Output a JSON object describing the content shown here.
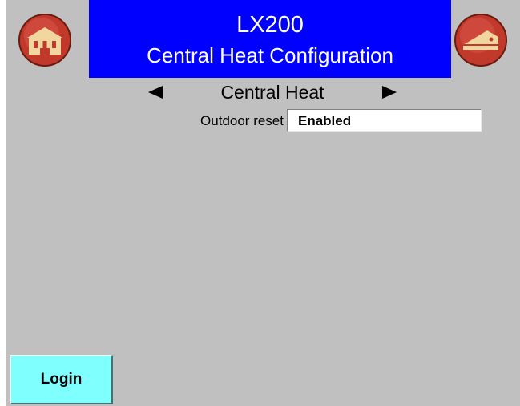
{
  "header": {
    "title": "LX200",
    "subtitle": "Central Heat Configuration",
    "bar_color": "#0000ff",
    "home_icon": "building-icon",
    "back_icon": "exit-icon",
    "button_color": "#c0392b"
  },
  "section_nav": {
    "title": "Central Heat",
    "prev_icon": "left-arrow-icon",
    "next_icon": "right-arrow-icon"
  },
  "settings": {
    "outdoor_reset": {
      "label": "Outdoor reset",
      "value": "Enabled"
    }
  },
  "footer": {
    "login_label": "Login",
    "login_color": "#80ffff"
  },
  "background_color": "#c0c0c0"
}
